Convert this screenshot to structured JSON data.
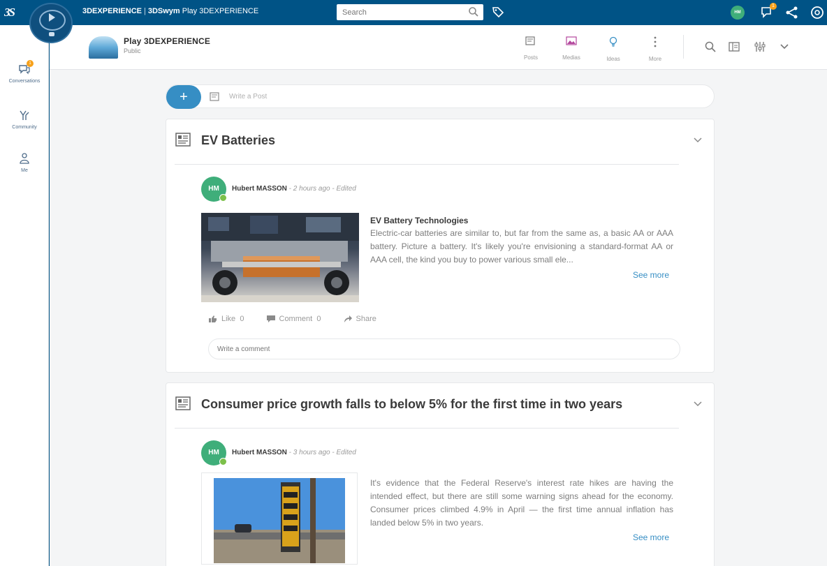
{
  "topbar": {
    "brand_bold": "3DEXPERIENCE",
    "brand_sep": "|",
    "brand_app": "3DSwym",
    "brand_context": "Play 3DEXPERIENCE",
    "search_placeholder": "Search",
    "avatar_initials": "HM",
    "notification_count": "1"
  },
  "sidebar": {
    "items": [
      {
        "label": "Conversations",
        "badge": "1"
      },
      {
        "label": "Community"
      },
      {
        "label": "Me"
      }
    ]
  },
  "community": {
    "title": "Play 3DEXPERIENCE",
    "subtitle": "Public",
    "tools": [
      {
        "label": "Posts"
      },
      {
        "label": "Medias"
      },
      {
        "label": "Ideas"
      },
      {
        "label": "More"
      }
    ]
  },
  "new_post": {
    "button": "+",
    "placeholder": "Write a Post"
  },
  "posts": [
    {
      "title": "EV Batteries",
      "author": "Hubert MASSON",
      "meta": " - 2 hours ago - Edited",
      "avatar": "HM",
      "article_title": "EV Battery Technologies",
      "article_text": "Electric-car batteries are similar to, but far from the same as, a basic AA or AAA battery. Picture a battery. It's likely you're envisioning a standard-format AA or AAA cell, the kind you buy to power various small ele...",
      "see_more": "See more",
      "like": "Like",
      "like_count": "0",
      "comment": "Comment",
      "comment_count": "0",
      "share": "Share",
      "comment_placeholder": "Write a comment"
    },
    {
      "title": "Consumer price growth falls to below 5% for the first time in two years",
      "author": "Hubert MASSON",
      "meta": " - 3 hours ago - Edited",
      "avatar": "HM",
      "article_text": "It's evidence that the Federal Reserve's interest rate hikes are having the intended effect, but there are still some warning signs ahead for the economy. Consumer prices climbed 4.9% in April — the first time annual inflation has landed below 5% in two years.",
      "see_more": "See more"
    }
  ],
  "colors": {
    "topbar": "#005386",
    "accent": "#368ec4",
    "avatar": "#3fae7a"
  }
}
